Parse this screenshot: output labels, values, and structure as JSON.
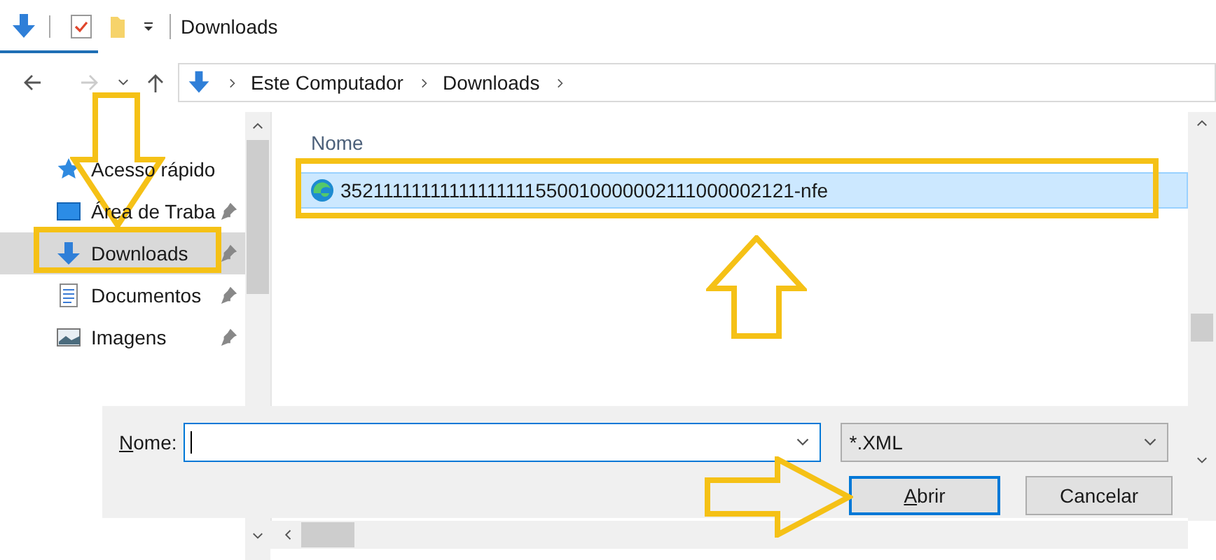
{
  "toolbar": {
    "title": "Downloads"
  },
  "address_bar": {
    "segments": [
      "Este Computador",
      "Downloads"
    ]
  },
  "sidebar": {
    "items": [
      {
        "label": "Acesso rápido",
        "kind": "star",
        "selected": false,
        "pinned": false
      },
      {
        "label": "Área de Traba",
        "kind": "desktop",
        "selected": false,
        "pinned": true
      },
      {
        "label": "Downloads",
        "kind": "download",
        "selected": true,
        "pinned": true
      },
      {
        "label": "Documentos",
        "kind": "document",
        "selected": false,
        "pinned": true
      },
      {
        "label": "Imagens",
        "kind": "image",
        "selected": false,
        "pinned": true
      }
    ]
  },
  "file_list": {
    "columns": [
      "Nome"
    ],
    "rows": [
      {
        "name": "35211111111111111111550010000002111000002121-nfe",
        "selected": true
      }
    ]
  },
  "dialog": {
    "name_label": "Nome:",
    "name_focused": true,
    "file_type": "*.XML",
    "buttons": [
      {
        "label": "Abrir",
        "default": true
      },
      {
        "label": "Cancelar",
        "default": false
      }
    ]
  },
  "annotations": [
    {
      "kind": "arrow-down"
    },
    {
      "kind": "box"
    },
    {
      "kind": "box"
    },
    {
      "kind": "arrow-up"
    },
    {
      "kind": "arrow-right"
    }
  ]
}
